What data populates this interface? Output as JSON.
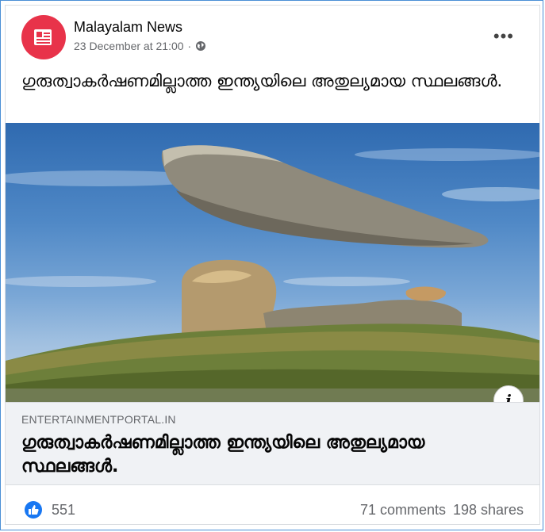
{
  "post": {
    "page_name": "Malayalam News",
    "timestamp": "23 December at 21:00",
    "separator": "·",
    "privacy_icon": "globe-icon",
    "more_icon": "more-options-icon",
    "more_glyph": "•••",
    "text": "ഗുരുത്വാകർഷണമില്ലാത്ത ഇന്ത്യയിലെ അതുല്യമായ സ്ഥലങ്ങള്‍."
  },
  "link_preview": {
    "domain": "ENTERTAINMENTPORTAL.IN",
    "title": "ഗുരുത്വാകർഷണമില്ലാത്ത ഇന്ത്യയിലെ അതുല്യമായ സ്ഥലങ്ങള്‍.",
    "info_glyph": "i"
  },
  "reactions": {
    "like_count": "551",
    "comments": "71 comments",
    "shares": "198 shares"
  },
  "colors": {
    "avatar_bg": "#e8334a",
    "like_blue": "#1877f2"
  }
}
